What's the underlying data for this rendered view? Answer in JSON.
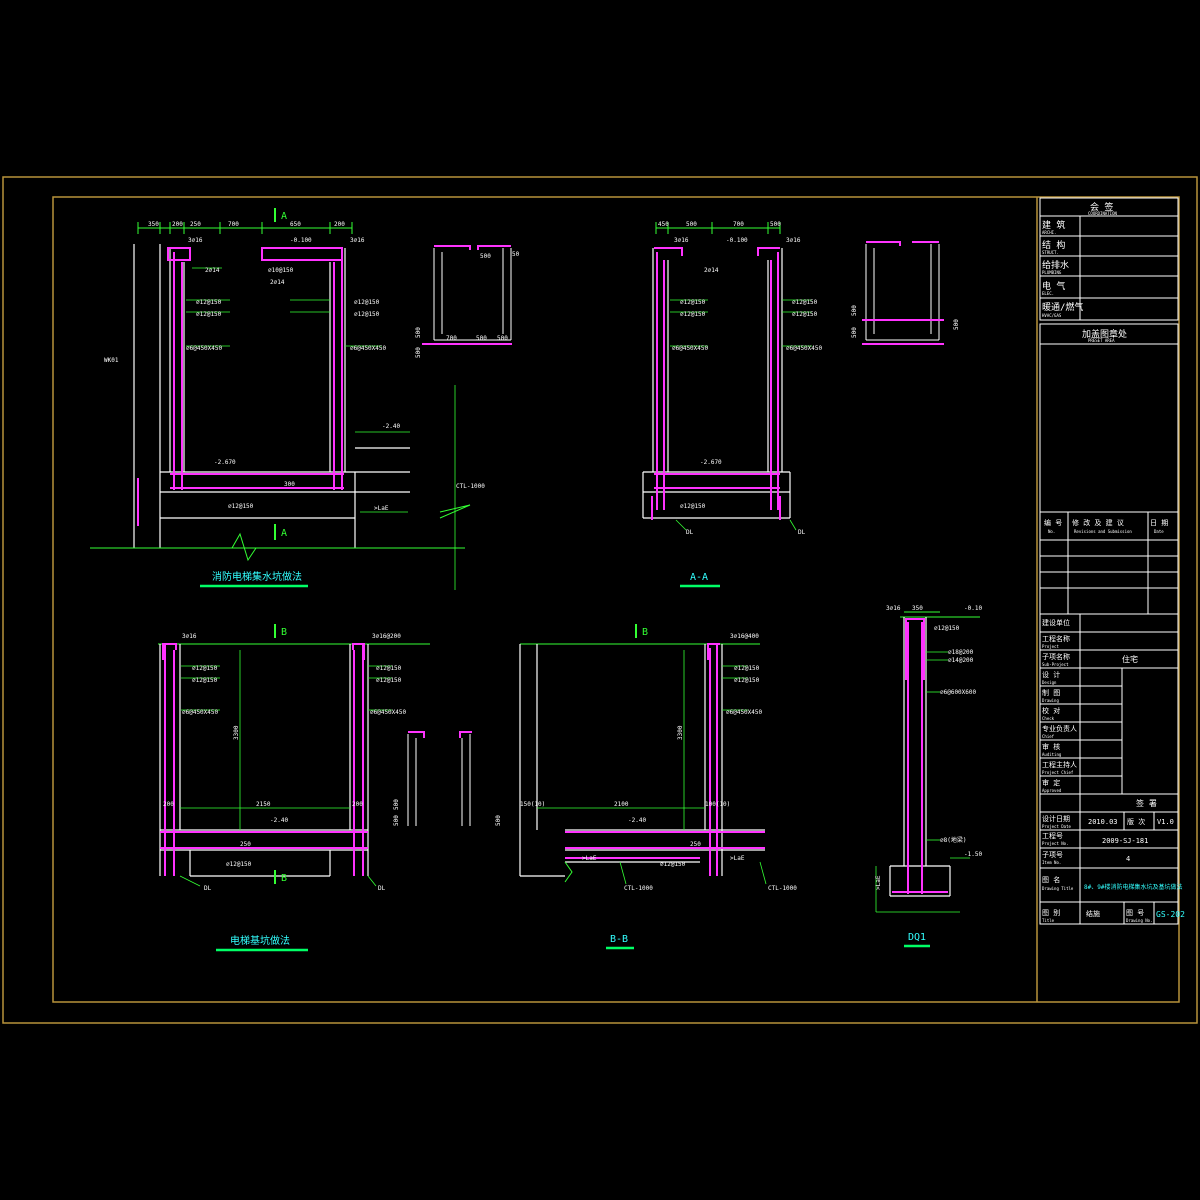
{
  "colors": {
    "background": "#000000",
    "frame": "#b8923a",
    "white": "#ffffff",
    "green": "#33ff33",
    "magenta": "#ff33ff",
    "cyan": "#33ffff",
    "title_bar": "#00ff66"
  },
  "drawings": {
    "pit_fire": {
      "title": "消防电梯集水坑做法",
      "section_mark_top": "A",
      "section_mark_bottom": "A",
      "dims_top": [
        "350",
        "200",
        "250",
        "700",
        "650",
        "200"
      ],
      "elev_top": "-0.100",
      "elev_floor": "-2.670",
      "elev_right": "-2.40",
      "rebar": [
        "3⌀16",
        "3⌀16",
        "⌀10@150",
        "2⌀14",
        "2⌀14",
        "⌀12@150",
        "⌀12@150",
        "⌀12@150",
        "⌀12@150",
        "⌀6@450X450",
        "⌀6@450X450",
        "⌀12@150"
      ],
      "depth": "300",
      "lae": ">LaE",
      "ctl": "CTL-1000",
      "side": "WK01"
    },
    "detail_small_top": {
      "dims": [
        "500",
        "700",
        "500",
        "500",
        "500",
        "500",
        "50"
      ]
    },
    "section_aa": {
      "title": "A-A",
      "dims_top": [
        "450",
        "500",
        "700",
        "500"
      ],
      "elev_top": "-0.100",
      "elev_floor": "-2.670",
      "rebar": [
        "3⌀16",
        "3⌀16",
        "2⌀14",
        "⌀12@150",
        "⌀12@150",
        "⌀12@150",
        "⌀12@150",
        "⌀6@450X450",
        "⌀6@450X450",
        "⌀12@150"
      ],
      "dl1": "DL",
      "dl2": "DL"
    },
    "detail_small_right": {
      "dims": [
        "500",
        "500",
        "500"
      ]
    },
    "pit_lift": {
      "title": "电梯基坑做法",
      "section_mark_top": "B",
      "section_mark_bottom": "B",
      "rebar": [
        "3⌀16",
        "3⌀16@200",
        "⌀12@150",
        "⌀12@150",
        "⌀12@150",
        "⌀12@150",
        "⌀6@450X450",
        "⌀6@450X450",
        "⌀12@150"
      ],
      "dim_width": "2150",
      "dim_height": "3300",
      "dim_200a": "200",
      "dim_200b": "200",
      "depth": "250",
      "elev_floor": "-2.40",
      "dl1": "DL",
      "dl2": "DL"
    },
    "detail_small_mid": {
      "dims": [
        "500",
        "500",
        "500"
      ]
    },
    "section_bb": {
      "title": "B-B",
      "section_mark": "B",
      "rebar": [
        "3⌀16@400",
        "⌀12@150",
        "⌀12@150",
        "⌀6@450X450",
        "⌀12@150"
      ],
      "dim_width": "2100",
      "dim_height": "3300",
      "dim_left": "150(10)",
      "dim_right": "100(10)",
      "elev_floor": "-2.40",
      "depth": "250",
      "lae1": ">LaE",
      "lae2": ">LaE",
      "ctl1": "CTL-1000",
      "ctl2": "CTL-1000"
    },
    "dq1": {
      "title": "DQ1",
      "dim_top": "350",
      "elev_top": "-0.10",
      "rebar": [
        "3⌀16",
        "⌀12@150",
        "⌀18@200",
        "⌀14@200",
        "⌀6@600X600",
        "⌀8(地梁)"
      ],
      "elev_bottom": "-1.50",
      "lae": ">LaE"
    }
  },
  "title_block": {
    "sign_header": "会 签",
    "sign_header_en": "COORDINATION",
    "sign_rows": [
      {
        "cn": "建  筑",
        "en": "ARCHI."
      },
      {
        "cn": "结  构",
        "en": "STRUCT."
      },
      {
        "cn": "给排水",
        "en": "PLUMBING"
      },
      {
        "cn": "电  气",
        "en": "ELEC."
      },
      {
        "cn": "暖通/燃气",
        "en": "HVAC/GAS"
      }
    ],
    "stamp_area": "加盖图章处",
    "stamp_area_en": "PRESET AREA",
    "revision_headers": [
      {
        "cn": "编 号",
        "en": "No."
      },
      {
        "cn": "修 改 及 建 议",
        "en": "Revisions and Submission"
      },
      {
        "cn": "日 期",
        "en": "Date"
      }
    ],
    "rows": [
      {
        "cn": "建设单位",
        "en": "",
        "value": ""
      },
      {
        "cn": "工程名称",
        "en": "Project",
        "value": ""
      },
      {
        "cn": "子项名称",
        "en": "Sub-Project",
        "value": "住宅"
      },
      {
        "cn": "设  计",
        "en": "Design",
        "value": ""
      },
      {
        "cn": "制  图",
        "en": "Drawing",
        "value": ""
      },
      {
        "cn": "校  对",
        "en": "Check",
        "value": ""
      },
      {
        "cn": "专业负责人",
        "en": "Chief",
        "value": ""
      },
      {
        "cn": "审  核",
        "en": "Auditing",
        "value": ""
      },
      {
        "cn": "工程主持人",
        "en": "Project Chief",
        "value": ""
      },
      {
        "cn": "审  定",
        "en": "Approved",
        "value": ""
      }
    ],
    "seal_label": "签 署",
    "design_date_label": "设计日期",
    "design_date_en": "Project Date",
    "design_date": "2010.03",
    "version_label": "版 次",
    "version": "V1.0",
    "project_no_label": "工程号",
    "project_no_en": "Project No.",
    "project_no": "2009-SJ-181",
    "subitem_no_label": "子项号",
    "subitem_no_en": "Item No.",
    "subitem_no": "4",
    "drawing_title_label": "图  名",
    "drawing_title_en": "Drawing Title",
    "drawing_title": "8#、9#楼消防电梯集水坑及基坑做法",
    "drawing_no_label": "图  别",
    "drawing_no_en": "Title",
    "discipline": "结施",
    "drawing_no_label2": "图  号",
    "drawing_no_en2": "Drawing No.",
    "drawing_no": "GS-202"
  }
}
